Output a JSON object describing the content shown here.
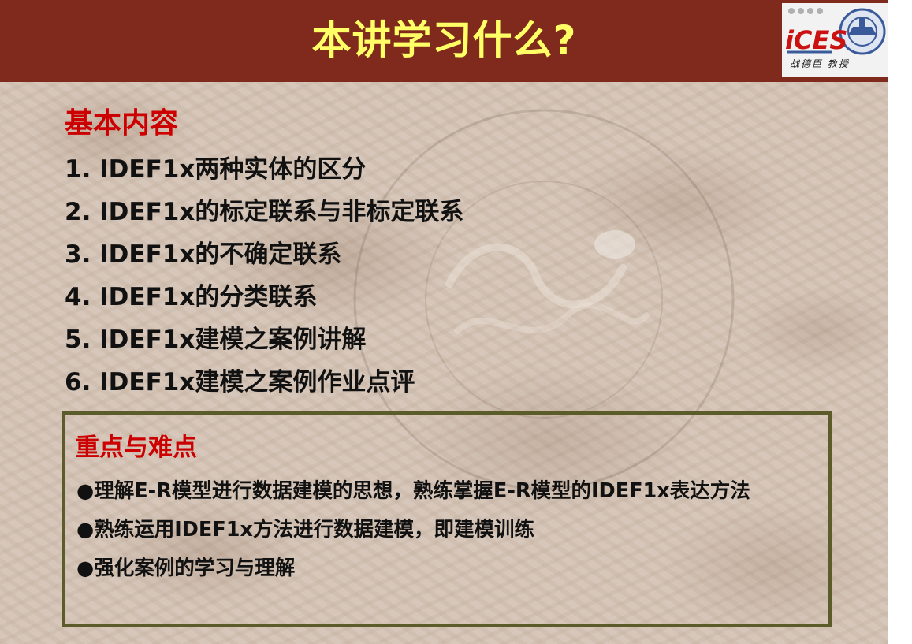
{
  "header": {
    "title": "本讲学习什么?",
    "logo_text": "iCES",
    "logo_author": "战德臣 教授"
  },
  "colors": {
    "header_bg": "#7f2a1d",
    "title": "#ffff66",
    "heading_red": "#cc0000",
    "box_border": "#5c5c2a",
    "body_text": "#111111"
  },
  "main": {
    "heading": "基本内容",
    "items": [
      "1. IDEF1x两种实体的区分",
      "2. IDEF1x的标定联系与非标定联系",
      "3. IDEF1x的不确定联系",
      "4. IDEF1x的分类联系",
      "5. IDEF1x建模之案例讲解",
      "6. IDEF1x建模之案例作业点评"
    ]
  },
  "key_points": {
    "heading": "重点与难点",
    "bullet_symbol": "●",
    "items": [
      "理解E-R模型进行数据建模的思想，熟练掌握E-R模型的IDEF1x表达方法",
      "熟练运用IDEF1x方法进行数据建模，即建模训练",
      "强化案例的学习与理解"
    ]
  }
}
